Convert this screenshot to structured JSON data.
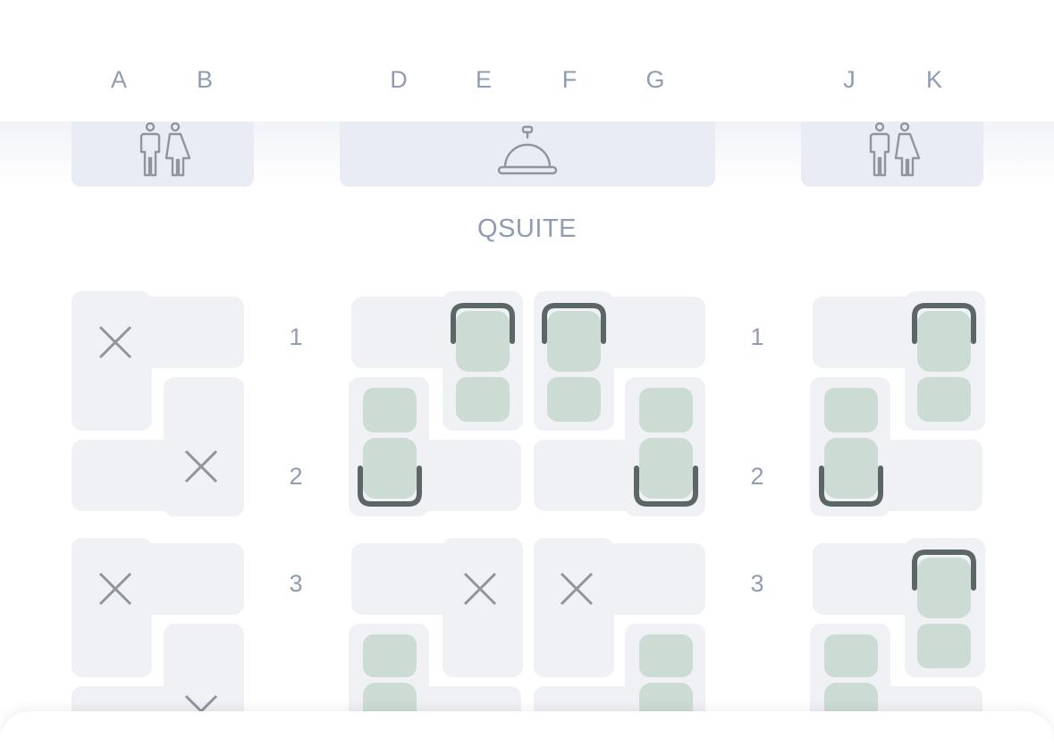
{
  "columns": [
    "A",
    "B",
    "D",
    "E",
    "F",
    "G",
    "J",
    "K"
  ],
  "cabin": {
    "label": "QSUITE"
  },
  "facilities": [
    {
      "type": "lavatory",
      "icon": "lavatory-icon"
    },
    {
      "type": "galley",
      "icon": "service-bell-icon"
    },
    {
      "type": "lavatory",
      "icon": "lavatory-icon"
    }
  ],
  "rows": [
    {
      "left": "1",
      "right": "1"
    },
    {
      "left": "2",
      "right": "2"
    },
    {
      "left": "3",
      "right": "3"
    }
  ],
  "seats": [
    {
      "id": "1A",
      "status": "unavailable"
    },
    {
      "id": "2B",
      "status": "unavailable"
    },
    {
      "id": "3A",
      "status": "unavailable"
    },
    {
      "id": "4B",
      "status": "unavailable"
    },
    {
      "id": "1E",
      "status": "available"
    },
    {
      "id": "2D",
      "status": "available"
    },
    {
      "id": "1F",
      "status": "available"
    },
    {
      "id": "2G",
      "status": "available"
    },
    {
      "id": "3E",
      "status": "unavailable"
    },
    {
      "id": "3F",
      "status": "unavailable"
    },
    {
      "id": "4D",
      "status": "available"
    },
    {
      "id": "4G",
      "status": "available"
    },
    {
      "id": "1K",
      "status": "available"
    },
    {
      "id": "2J",
      "status": "available"
    },
    {
      "id": "3K",
      "status": "available"
    },
    {
      "id": "4J",
      "status": "available"
    }
  ],
  "colors": {
    "label": "#8f9cb2",
    "pod": "#f0f1f5",
    "seat_fill": "#cddbd5",
    "seat_outline": "#5d6667",
    "unavailable_x": "#8e959b",
    "facility": "#e9ecf5"
  }
}
